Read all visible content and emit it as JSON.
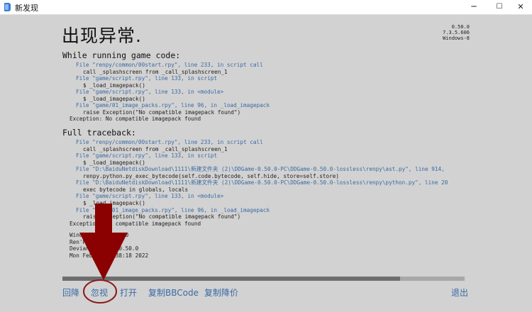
{
  "window": {
    "title": "新发现",
    "controls": {
      "minimize": "─",
      "maximize": "☐",
      "close": "✕"
    }
  },
  "heading": "出现异常.",
  "version_info": [
    "0.50.0",
    "7.3.5.606",
    "Windows-8"
  ],
  "sections": {
    "while_running": {
      "title": "While running game code:",
      "lines": [
        {
          "type": "file",
          "text": "File \"renpy/common/00start.rpy\", line 233, in script call"
        },
        {
          "type": "code",
          "text": "call _splashscreen from _call_splashscreen_1"
        },
        {
          "type": "file",
          "text": "File \"game/script.rpy\", line 133, in script"
        },
        {
          "type": "code",
          "text": "$ _load_imagepack()"
        },
        {
          "type": "file",
          "text": "File \"game/script.rpy\", line 133, in <module>"
        },
        {
          "type": "code",
          "text": "$ _load_imagepack()"
        },
        {
          "type": "file",
          "text": "File \"game/01_image_packs.rpy\", line 96, in _load_imagepack"
        },
        {
          "type": "code",
          "text": "raise Exception(\"No compatible imagepack found\")"
        },
        {
          "type": "exc",
          "text": "Exception: No compatible imagepack found"
        }
      ]
    },
    "full_traceback": {
      "title": "Full traceback:",
      "lines": [
        {
          "type": "file",
          "text": "File \"renpy/common/00start.rpy\", line 233, in script call"
        },
        {
          "type": "code",
          "text": "call _splashscreen from _call_splashscreen_1"
        },
        {
          "type": "file",
          "text": "File \"game/script.rpy\", line 133, in script"
        },
        {
          "type": "code",
          "text": "$ _load_imagepack()"
        },
        {
          "type": "file",
          "text": "File \"D:\\BaiduNetdiskDownload\\1111\\新建文件夹 (2)\\DDGame-0.50.0-PC\\DDGame-0.50.0-lossless\\renpy\\ast.py\", line 914,"
        },
        {
          "type": "code",
          "text": "renpy.python.py_exec_bytecode(self.code.bytecode, self.hide, store=self.store)"
        },
        {
          "type": "file",
          "text": "File \"D:\\BaiduNetdiskDownload\\1111\\新建文件夹 (2)\\DDGame-0.50.0-PC\\DDGame-0.50.0-lossless\\renpy\\python.py\", line 20"
        },
        {
          "type": "code",
          "text": "exec bytecode in globals, locals"
        },
        {
          "type": "file",
          "text": "File \"game/script.rpy\", line 133, in <module>"
        },
        {
          "type": "code",
          "text": "$ _load_imagepack()"
        },
        {
          "type": "file",
          "text": "File \"game/01_image_packs.rpy\", line 96, in _load_imagepack"
        },
        {
          "type": "code",
          "text": "raise Exception(\"No compatible imagepack found\")"
        },
        {
          "type": "exc",
          "text": "Exception: No compatible imagepack found"
        }
      ]
    }
  },
  "system_info": [
    "Windows-8-6.2.9200",
    "Ren'Py 7.3.5.606",
    "Deviant Series 0.50.0",
    "Mon Feb 21 13:38:18 2022"
  ],
  "progress": {
    "fraction": 0.84
  },
  "actions": {
    "rollback": "回降",
    "ignore": "忽视",
    "open": "打开",
    "copy_bbcode": "复制BBCode",
    "copy_markdown": "复制降价",
    "quit": "退出"
  },
  "annotation_colors": {
    "arrow": "#8b0000",
    "circle": "#8b1a1a"
  }
}
